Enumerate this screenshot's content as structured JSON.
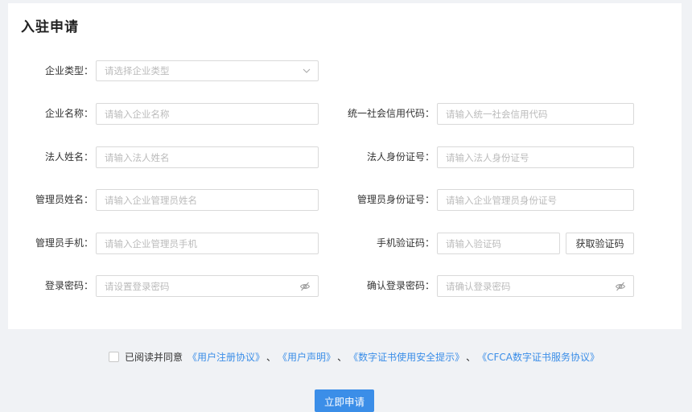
{
  "page_title": "入驻申请",
  "form": {
    "company_type": {
      "label": "企业类型：",
      "placeholder": "请选择企业类型"
    },
    "company_name": {
      "label": "企业名称：",
      "placeholder": "请输入企业名称"
    },
    "credit_code": {
      "label": "统一社会信用代码：",
      "placeholder": "请输入统一社会信用代码"
    },
    "legal_name": {
      "label": "法人姓名：",
      "placeholder": "请输入法人姓名"
    },
    "legal_id": {
      "label": "法人身份证号：",
      "placeholder": "请输入法人身份证号"
    },
    "admin_name": {
      "label": "管理员姓名：",
      "placeholder": "请输入企业管理员姓名"
    },
    "admin_id": {
      "label": "管理员身份证号：",
      "placeholder": "请输入企业管理员身份证号"
    },
    "admin_phone": {
      "label": "管理员手机：",
      "placeholder": "请输入企业管理员手机"
    },
    "sms_code": {
      "label": "手机验证码：",
      "placeholder": "请输入验证码",
      "button": "获取验证码"
    },
    "password": {
      "label": "登录密码：",
      "placeholder": "请设置登录密码"
    },
    "confirm_password": {
      "label": "确认登录密码：",
      "placeholder": "请确认登录密码"
    }
  },
  "agreement": {
    "prefix": "已阅读并同意",
    "links": [
      "《用户注册协议》",
      "《用户声明》",
      "《数字证书使用安全提示》",
      "《CFCA数字证书服务协议》"
    ],
    "separator": "、",
    "checked": false
  },
  "submit_label": "立即申请",
  "icons": {
    "select_arrow": "chevron-down-icon",
    "password_toggle": "eye-off-icon"
  },
  "colors": {
    "primary": "#3b8ee8",
    "background": "#f0f2f5"
  }
}
